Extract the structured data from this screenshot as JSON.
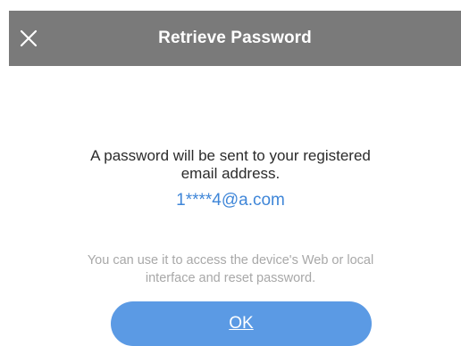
{
  "header": {
    "title": "Retrieve Password",
    "close_icon": "close-icon",
    "background": "#7a7a7a"
  },
  "message": {
    "line1": "A password will be sent to your registered",
    "line2": "email address.",
    "email": "1****4@a.com",
    "email_color": "#3f86d8"
  },
  "hint": {
    "line1": "You can use it to access the device's Web or local",
    "line2": "interface and reset password."
  },
  "ok_button": {
    "label": "OK",
    "color": "#5b9ae4"
  }
}
